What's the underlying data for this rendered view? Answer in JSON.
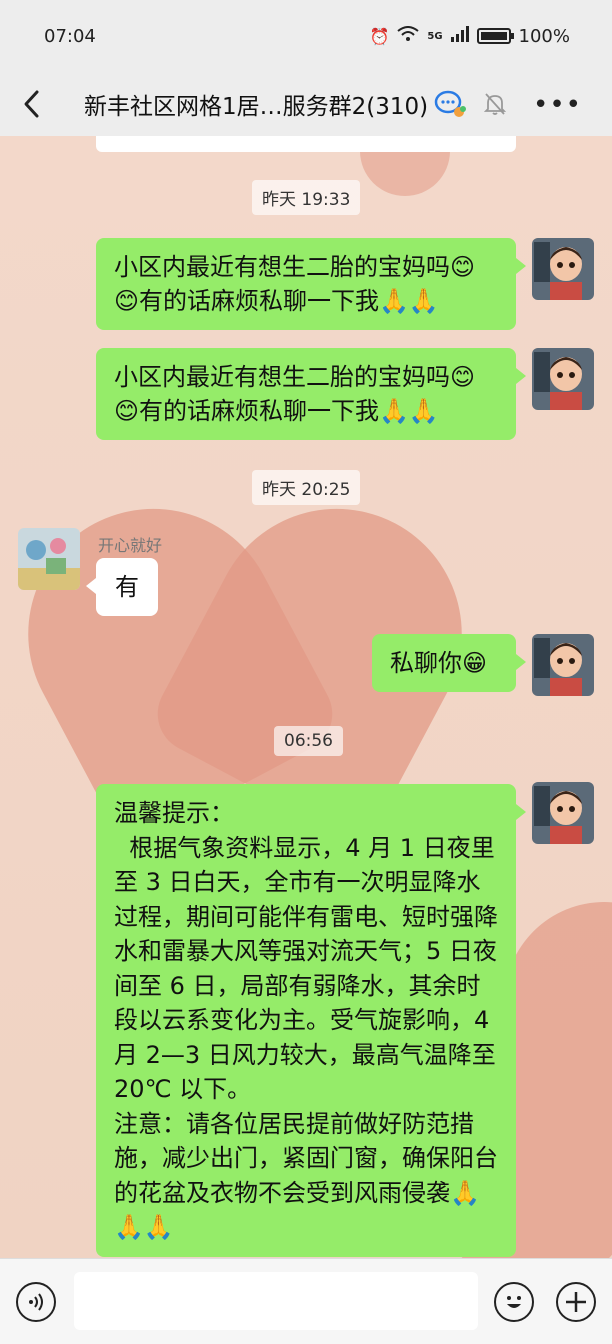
{
  "status": {
    "time": "07:04",
    "network": "5G",
    "battery": "100%"
  },
  "header": {
    "title": "新丰社区网格1居…服务群2(310)"
  },
  "messages": {
    "ts1": "昨天 19:33",
    "m1": "小区内最近有想生二胎的宝妈吗😊😊有的话麻烦私聊一下我🙏🙏",
    "m2": "小区内最近有想生二胎的宝妈吗😊😊有的话麻烦私聊一下我🙏🙏",
    "ts2": "昨天 20:25",
    "sender": "开心就好",
    "m3": "有",
    "m4": "私聊你😁",
    "ts3": "06:56",
    "m5": "温馨提示：\n  根据气象资料显示，4 月 1 日夜里至 3 日白天，全市有一次明显降水过程，期间可能伴有雷电、短时强降水和雷暴大风等强对流天气；5 日夜间至 6 日，局部有弱降水，其余时段以云系变化为主。受气旋影响，4 月 2—3 日风力较大，最高气温降至 20℃ 以下。\n注意：请各位居民提前做好防范措施，减少出门，紧固门窗，确保阳台的花盆及衣物不会受到风雨侵袭🙏🙏🙏"
  },
  "colors": {
    "my_bubble": "#95ec69",
    "their_bubble": "#ffffff",
    "bar": "#ededed"
  }
}
